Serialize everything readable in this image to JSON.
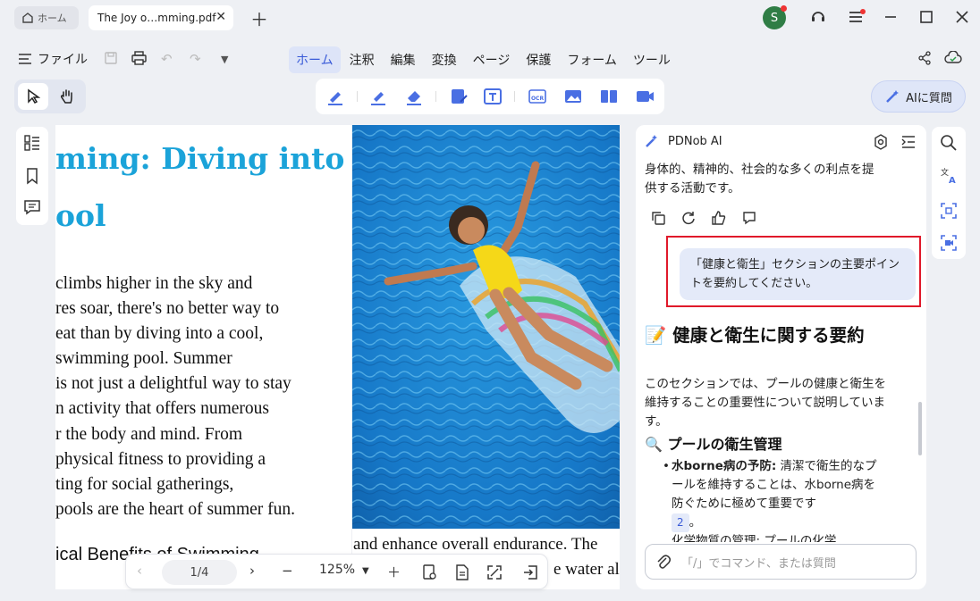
{
  "tabs": {
    "home_label": "ホーム",
    "doc_label": "The Joy o…mming.pdf"
  },
  "user": {
    "initial": "S"
  },
  "menu": {
    "file_label": "ファイル",
    "items": [
      "ホーム",
      "注釈",
      "編集",
      "変換",
      "ページ",
      "保護",
      "フォーム",
      "ツール"
    ],
    "active": "ホーム"
  },
  "ai_button_label": "AIに質問",
  "document": {
    "heading_lines": [
      "ming: Diving into",
      "ool"
    ],
    "body_lines": [
      "climbs higher in the sky and",
      "res soar, there's no better way to",
      "eat than by diving into a cool,",
      "swimming pool. Summer",
      "is not just a delightful way to stay",
      "n activity that offers numerous",
      "r the body and mind. From",
      "physical fitness to providing a",
      "ting for social gatherings,",
      "pools are the heart of summer fun."
    ],
    "subheading": "ical Benefits of Swimming",
    "right_col_lines": [
      "and enhance overall endurance. The",
      "e water al"
    ]
  },
  "nav": {
    "page": "1/4",
    "zoom": "125%"
  },
  "ai_panel": {
    "title": "PDNob AI",
    "previous_answer": "身体的、精神的、社会的な多くの利点を提供する活動です。",
    "user_message": "「健康と衛生」セクションの主要ポイントを要約してください。",
    "answer_title": "📝 健康と衛生に関する要約",
    "answer_body": "このセクションでは、プールの健康と衛生を維持することの重要性について説明しています。",
    "answer_sub": "🔍 プールの衛生管理",
    "bullet_label": "水borne病の予防:",
    "bullet_text": " 清潔で衛生的なプールを維持することは、水borne病を防ぐために極めて重要です",
    "bullet_ref": "2",
    "bullet_end": "。",
    "next_bullet_partial": "化学物質の管理: プールの化学",
    "input_placeholder": "「/」でコマンド、または質問"
  },
  "colors": {
    "accent": "#3a5bd8",
    "heading": "#1ba3d9",
    "highlight_box": "#e0192a"
  }
}
